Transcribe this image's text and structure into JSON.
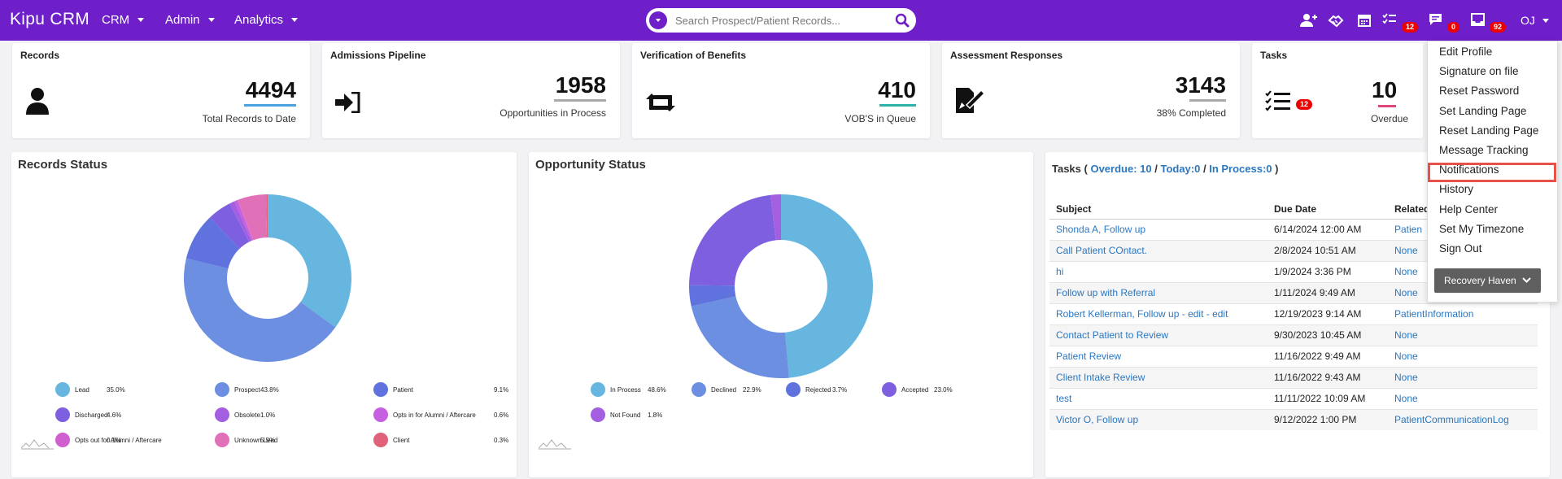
{
  "brand": "Kipu CRM",
  "nav": [
    "CRM",
    "Admin",
    "Analytics"
  ],
  "search": {
    "placeholder": "Search Prospect/Patient Records..."
  },
  "header_badges": {
    "tasks": "12",
    "messages": "0",
    "inbox": "92"
  },
  "user_initials": "OJ",
  "stats": [
    {
      "title": "Records",
      "value": "4494",
      "subtitle": "Total Records to Date",
      "icon": "person-icon",
      "accent": "#4aa3df"
    },
    {
      "title": "Admissions Pipeline",
      "value": "1958",
      "subtitle": "Opportunities in Process",
      "icon": "sign-in-icon",
      "accent": "#aaaaaa"
    },
    {
      "title": "Verification of Benefits",
      "value": "410",
      "subtitle": "VOB'S in Queue",
      "icon": "retweet-icon",
      "accent": "#2bb3a3"
    },
    {
      "title": "Assessment Responses",
      "value": "3143",
      "subtitle": "38% Completed",
      "icon": "document-edit-icon",
      "accent": "#aaaaaa"
    },
    {
      "title": "Tasks",
      "value": "10",
      "subtitle": "Overdue",
      "icon": "task-list-icon",
      "accent": "#e0457b",
      "badge": "12"
    }
  ],
  "records_status": {
    "title": "Records Status",
    "legend": [
      {
        "label": "Lead",
        "pct": "35.0%",
        "color": "#66b6e0"
      },
      {
        "label": "Prospect",
        "pct": "43.8%",
        "color": "#6c8fe2"
      },
      {
        "label": "Patient",
        "pct": "9.1%",
        "color": "#5f72de"
      },
      {
        "label": "Discharged",
        "pct": "4.6%",
        "color": "#7d5fe0"
      },
      {
        "label": "Obsolete",
        "pct": "1.0%",
        "color": "#a45fe0"
      },
      {
        "label": "Opts in for Alumni / Aftercare",
        "pct": "0.6%",
        "color": "#c760e0"
      },
      {
        "label": "Opts out for Alumni / Aftercare",
        "pct": "0.1%",
        "color": "#d05fd0"
      },
      {
        "label": "Unknown Lead",
        "pct": "5.5%",
        "color": "#e070b8"
      },
      {
        "label": "Client",
        "pct": "0.3%",
        "color": "#e0627a"
      }
    ]
  },
  "opportunity_status": {
    "title": "Opportunity Status",
    "legend": [
      {
        "label": "In Process",
        "pct": "48.6%",
        "color": "#66b6e0"
      },
      {
        "label": "Declined",
        "pct": "22.9%",
        "color": "#6c8fe2"
      },
      {
        "label": "Rejected",
        "pct": "3.7%",
        "color": "#5f72de"
      },
      {
        "label": "Accepted",
        "pct": "23.0%",
        "color": "#7d5fe0"
      },
      {
        "label": "Not Found",
        "pct": "1.8%",
        "color": "#a45fe0"
      }
    ]
  },
  "tasks": {
    "label": "Tasks",
    "overdue": "Overdue: 10",
    "today": "Today:0",
    "in_process": "In Process:0",
    "columns": [
      "Subject",
      "Due Date",
      "Related"
    ],
    "rows": [
      {
        "subject": "Shonda A, Follow up",
        "due": "6/14/2024 12:00 AM",
        "related": "Patien"
      },
      {
        "subject": "Call Patient COntact.",
        "due": "2/8/2024 10:51 AM",
        "related": "None"
      },
      {
        "subject": "hi",
        "due": "1/9/2024 3:36 PM",
        "related": "None"
      },
      {
        "subject": "Follow up with Referral",
        "due": "1/11/2024 9:49 AM",
        "related": "None"
      },
      {
        "subject": "Robert Kellerman, Follow up - edit - edit",
        "due": "12/19/2023 9:14 AM",
        "related": "PatientInformation"
      },
      {
        "subject": "Contact Patient to Review",
        "due": "9/30/2023 10:45 AM",
        "related": "None"
      },
      {
        "subject": "Patient Review",
        "due": "11/16/2022 9:49 AM",
        "related": "None"
      },
      {
        "subject": "Client Intake Review",
        "due": "11/16/2022 9:43 AM",
        "related": "None"
      },
      {
        "subject": "test",
        "due": "11/11/2022 10:09 AM",
        "related": "None"
      },
      {
        "subject": "Victor O, Follow up",
        "due": "9/12/2022 1:00 PM",
        "related": "PatientCommunicationLog"
      }
    ]
  },
  "user_menu": {
    "items": [
      "Edit Profile",
      "Signature on file",
      "Reset Password",
      "Set Landing Page",
      "Reset Landing Page",
      "Message Tracking",
      "Notifications",
      "History",
      "Help Center",
      "Set My Timezone",
      "Sign Out"
    ],
    "selected": "Notifications",
    "location": "Recovery Haven"
  }
}
